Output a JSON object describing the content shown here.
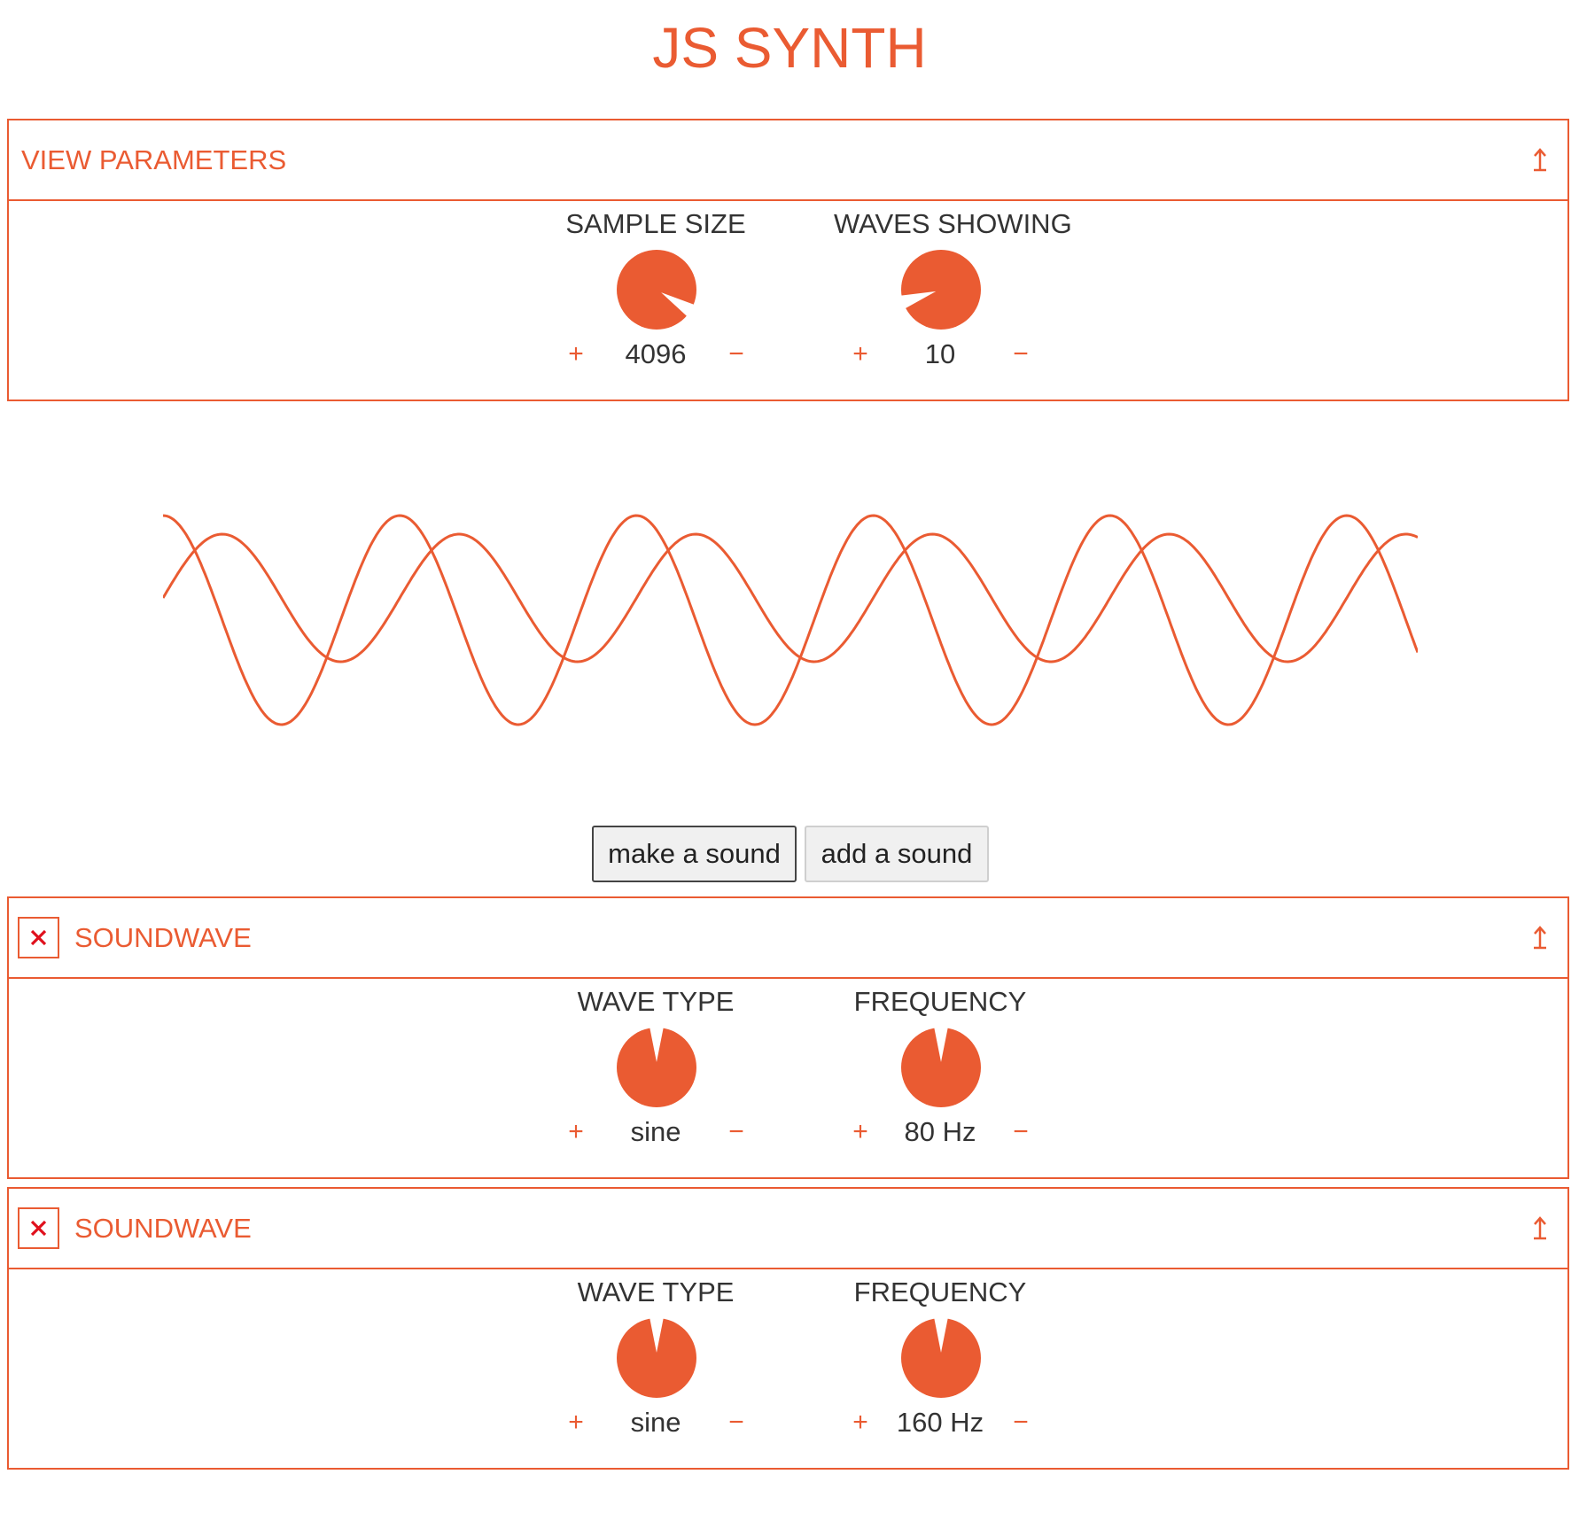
{
  "app": {
    "title": "JS SYNTH",
    "accent_color": "#ea5b32"
  },
  "view_parameters": {
    "title": "VIEW PARAMETERS",
    "collapse_icon": "collapse-arrow-icon",
    "controls": [
      {
        "label": "SAMPLE SIZE",
        "value": "4096",
        "plus": "+",
        "minus": "−",
        "knob_level": 0.95
      },
      {
        "label": "WAVES SHOWING",
        "value": "10",
        "plus": "+",
        "minus": "−",
        "knob_level": 0.1
      }
    ]
  },
  "oscilloscope": {
    "waves": [
      {
        "frequency_hz": 80,
        "type": "sine"
      },
      {
        "frequency_hz": 160,
        "type": "sine"
      }
    ]
  },
  "actions": {
    "make_sound": "make a sound",
    "add_sound": "add a sound"
  },
  "soundwaves": [
    {
      "title": "SOUNDWAVE",
      "remove_icon": "close-icon",
      "collapse_icon": "collapse-arrow-icon",
      "controls": [
        {
          "label": "WAVE TYPE",
          "value": "sine",
          "plus": "+",
          "minus": "−",
          "knob_level": 0.5
        },
        {
          "label": "FREQUENCY",
          "value": "80 Hz",
          "plus": "+",
          "minus": "−",
          "knob_level": 0.5
        }
      ]
    },
    {
      "title": "SOUNDWAVE",
      "remove_icon": "close-icon",
      "collapse_icon": "collapse-arrow-icon",
      "controls": [
        {
          "label": "WAVE TYPE",
          "value": "sine",
          "plus": "+",
          "minus": "−",
          "knob_level": 0.5
        },
        {
          "label": "FREQUENCY",
          "value": "160 Hz",
          "plus": "+",
          "minus": "−",
          "knob_level": 0.5
        }
      ]
    }
  ]
}
